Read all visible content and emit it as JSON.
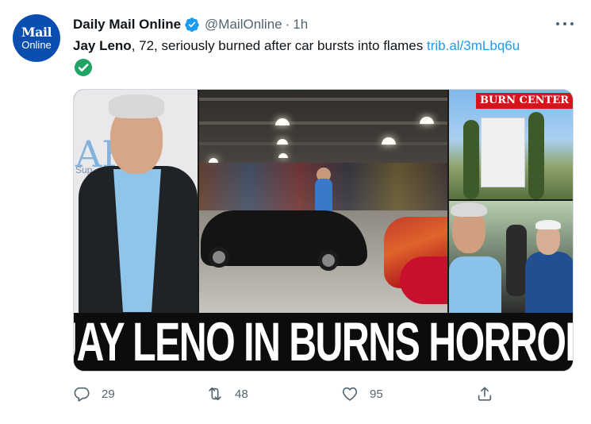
{
  "account": {
    "avatar_line1": "Mail",
    "avatar_line2": "Online",
    "name": "Daily Mail Online",
    "handle": "@MailOnline",
    "separator": "·",
    "time": "1h"
  },
  "tweet": {
    "bold_part": "Jay Leno",
    "text_part": ", 72, seriously burned after car bursts into flames ",
    "link": "trib.al/3mLbq6u"
  },
  "media": {
    "sign_text": "BURN CENTER",
    "headline": "JAY LENO IN BURNS HORROR",
    "left_logo_letter": "AF",
    "left_logo_sub": "Sup"
  },
  "actions": {
    "replies": "29",
    "retweets": "48",
    "likes": "95"
  },
  "colors": {
    "link": "#1d9bf0",
    "verified": "#1d9bf0",
    "muted": "#536471",
    "avatar_bg": "#0a4fb0"
  },
  "icons": {
    "verified": "verified-badge-icon",
    "more": "more-options-icon",
    "reply": "reply-icon",
    "retweet": "retweet-icon",
    "like": "heart-icon",
    "share": "share-icon",
    "check": "check-mark-emoji-icon"
  }
}
